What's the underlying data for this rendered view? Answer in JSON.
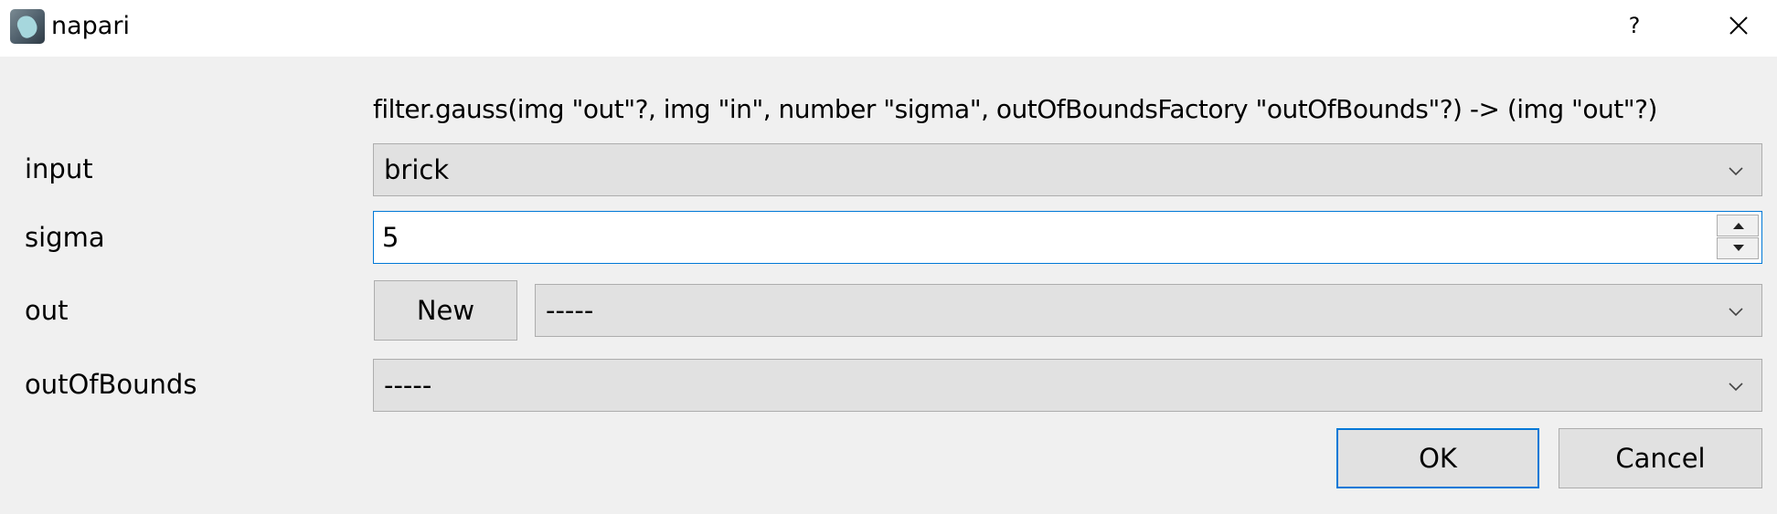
{
  "window": {
    "title": "napari",
    "help_label": "?",
    "app_icon": "napari-logo-icon",
    "close_icon": "close-icon"
  },
  "form": {
    "signature": "filter.gauss(img \"out\"?, img \"in\", number \"sigma\", outOfBoundsFactory \"outOfBounds\"?) -> (img \"out\"?)",
    "input": {
      "label": "input",
      "value": "brick"
    },
    "sigma": {
      "label": "sigma",
      "value": "5"
    },
    "out": {
      "label": "out",
      "new_label": "New",
      "value": "-----"
    },
    "outOfBounds": {
      "label": "outOfBounds",
      "value": "-----"
    }
  },
  "buttons": {
    "ok_label": "OK",
    "cancel_label": "Cancel"
  },
  "colors": {
    "background": "#f0f0f0",
    "titlebar": "#ffffff",
    "accent": "#0078d7",
    "control": "#e1e1e1",
    "border": "#adadad"
  }
}
